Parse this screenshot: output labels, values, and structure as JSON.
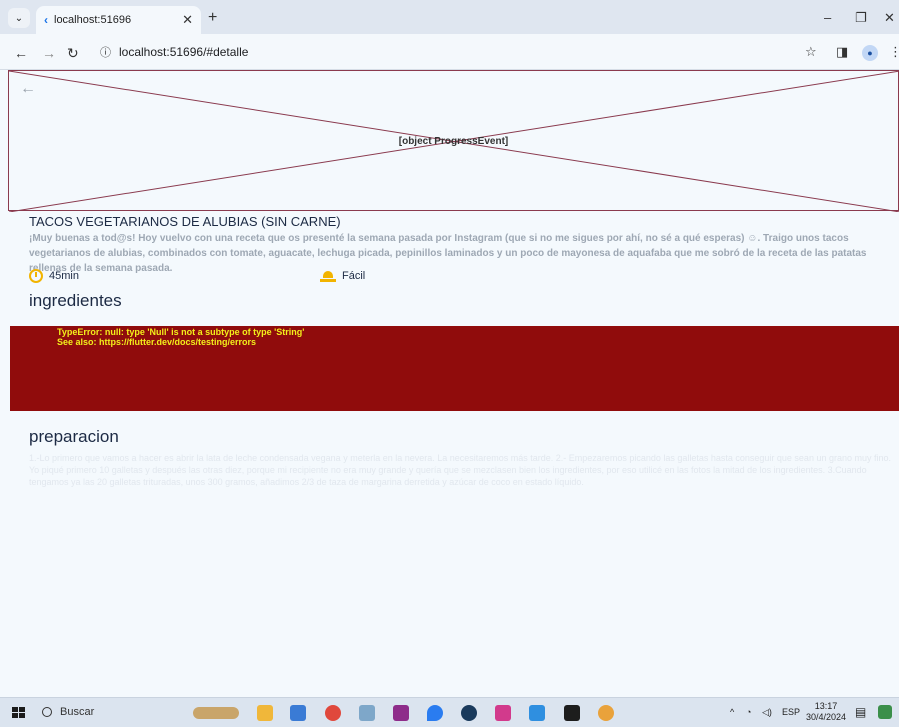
{
  "browser": {
    "tab_title": "localhost:51696",
    "url": "localhost:51696/#detalle",
    "new_tab_label": "+",
    "icons": [
      "tab-list-icon",
      "back-icon",
      "forward-icon",
      "reload-icon",
      "info-icon",
      "star-icon",
      "sidepanel-icon",
      "profile-icon",
      "menu-icon",
      "minimize-icon",
      "restore-icon",
      "close-icon"
    ]
  },
  "hero": {
    "error_text": "[object ProgressEvent]",
    "border_color": "#8a3a4e"
  },
  "recipe": {
    "title": "TACOS VEGETARIANOS DE ALUBIAS (SIN CARNE)",
    "description": "¡Muy buenas a tod@s! Hoy vuelvo con una receta que os presenté la semana pasada por Instagram (que si no me sigues por ahí, no sé a qué esperas) ☺. Traigo unos tacos vegetarianos de alubias, combinados con tomate, aguacate, lechuga picada, pepinillos laminados y un poco de mayonesa de aquafaba que me sobró de la receta de las patatas rellenas de la semana pasada.",
    "time": "45min",
    "difficulty": "Fácil",
    "accent_color": "#f2b400"
  },
  "sections": {
    "ingredients_title": "ingredientes",
    "preparation_title": "preparacion",
    "preparation_text": "1.-Lo primero que vamos a hacer es abrir la lata de leche condensada vegana y meterla en la nevera. La necesitaremos más tarde. 2.- Empezaremos picando las galletas hasta conseguir que sean un grano muy fino. Yo piqué primero 10 galletas y después las otras diez, porque mi recipiente no era muy grande y quería que se mezclasen bien los ingredientes, por eso utilicé en las fotos la mitad de los ingredientes. 3.Cuando tengamos ya las 20 galletas trituradas, unos 300 gramos, añadimos 2/3 de taza de margarina derretida y azúcar de coco en estado líquido."
  },
  "error_box": {
    "line1": "TypeError: null: type 'Null' is not a subtype of type 'String'",
    "line2": "See also: https://flutter.dev/docs/testing/errors",
    "bg_color": "#900c0c",
    "text_color": "#f3ef1b"
  },
  "taskbar": {
    "search_label": "Buscar",
    "language": "ESP",
    "time": "13:17",
    "date": "30/4/2024"
  }
}
